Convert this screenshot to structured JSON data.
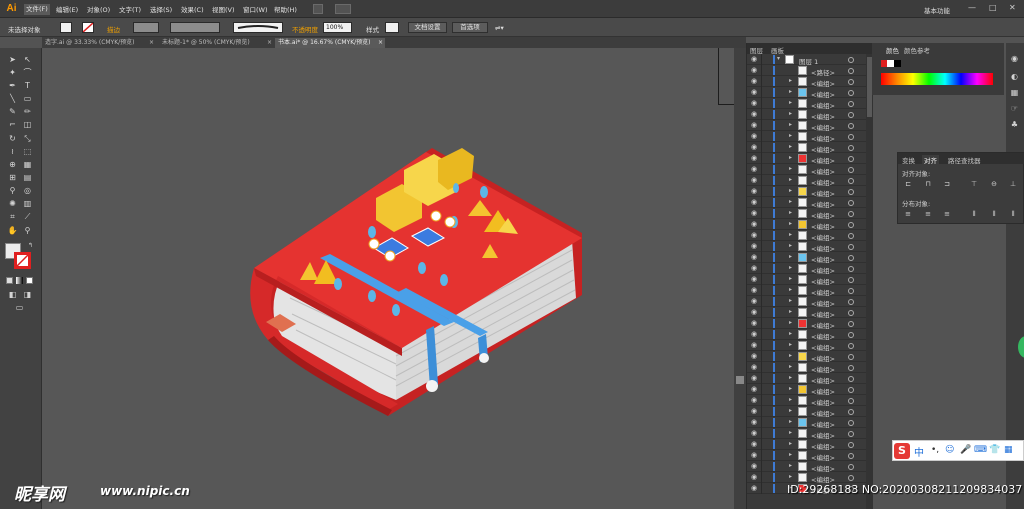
{
  "app": {
    "logo": "Ai",
    "workspace": "基本功能",
    "window_controls": [
      "—",
      "□",
      "✕"
    ]
  },
  "menu": [
    "文件(F)",
    "编辑(E)",
    "对象(O)",
    "文字(T)",
    "选择(S)",
    "效果(C)",
    "视图(V)",
    "窗口(W)",
    "帮助(H)"
  ],
  "control_bar": {
    "selection_status": "未选择对象",
    "stroke_label": "描边",
    "opacity_label": "不透明度",
    "opacity_value": "100%",
    "style_label": "样式",
    "doc_setup_button": "文档设置",
    "preferences_button": "首选项"
  },
  "doc_tabs": [
    {
      "label": "造字.ai @ 33.33% (CMYK/预览)",
      "close": "×",
      "active": false
    },
    {
      "label": "未标题-1* @ 50% (CMYK/预览)",
      "close": "×",
      "active": false
    },
    {
      "label": "书本.ai* @ 16.67% (CMYK/预览)",
      "close": "×",
      "active": true
    }
  ],
  "layers_panel": {
    "tabs": [
      "图层",
      "画板"
    ],
    "top_layer": "图层 1",
    "first_item": "<路径>",
    "item_label": "<编组>",
    "row_count": 40
  },
  "color_panel": {
    "tabs": [
      "颜色",
      "颜色参考"
    ]
  },
  "align_panel": {
    "tabs": [
      "变换",
      "对齐",
      "路径查找器"
    ],
    "align_objects_label": "对齐对象:",
    "distribute_objects_label": "分布对象:"
  },
  "ime_bar": {
    "logo": "S",
    "mode": "中"
  },
  "watermark": {
    "site_name": "昵享网",
    "url": "www.nipic.cn",
    "id_text": "ID:29268183 NO:20200308211209834037"
  }
}
